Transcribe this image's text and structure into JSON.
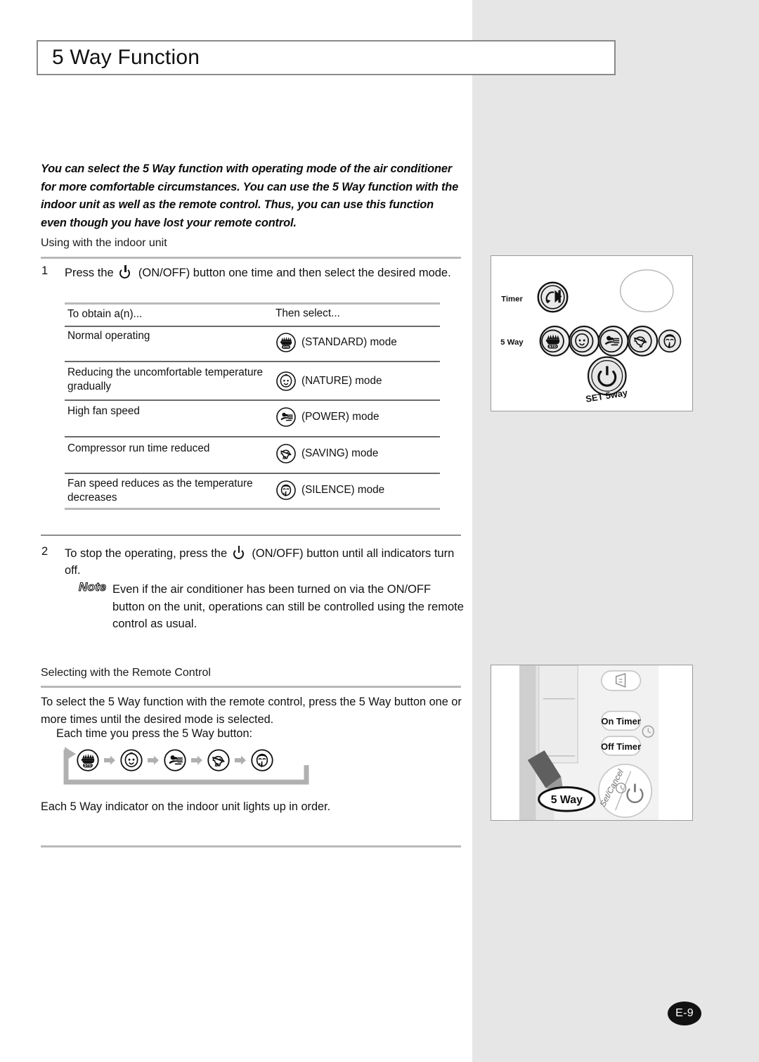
{
  "page": {
    "title": "5 Way Function",
    "footer_label": "E-9",
    "accent_gray": "#e6e6e6",
    "rule_color": "#b9b9b9"
  },
  "intro": {
    "paragraph": "You can select the 5 Way function with operating mode of the air conditioner for more comfortable circumstances. You can use the 5 Way function with the indoor unit as well as the remote control. Thus, you can use this function even though you have lost your remote control."
  },
  "indoor_section": {
    "subhead": "Using with the indoor unit",
    "step1": {
      "number": "1",
      "text_before_icon": "Press the",
      "icon": "power-on-off-icon",
      "text_after_icon": "(ON/OFF) button one time and then select the desired mode."
    },
    "table": {
      "headers": {
        "left": "To obtain a(n)...",
        "right": "Then select..."
      },
      "rows": [
        {
          "condition": "Normal operating",
          "icon": "standard-mode-icon",
          "mode_label": "(STANDARD) mode"
        },
        {
          "condition": "Reducing the uncomfortable temperature gradually",
          "icon": "nature-mode-icon",
          "mode_label": "(NATURE) mode"
        },
        {
          "condition": "High fan speed",
          "icon": "power-mode-icon",
          "mode_label": "(POWER) mode"
        },
        {
          "condition": "Compressor run time reduced",
          "icon": "saving-mode-icon",
          "mode_label": "(SAVING) mode"
        },
        {
          "condition": "Fan speed reduces as the temperature decreases",
          "icon": "silence-mode-icon",
          "mode_label": "(SILENCE) mode"
        }
      ]
    },
    "step2": {
      "number": "2",
      "text_before_icon": "To stop the operating, press the",
      "icon": "power-on-off-icon",
      "text_after_icon": "(ON/OFF) button until all indicators turn off."
    },
    "note": {
      "label": "Note",
      "text": "Even if the air conditioner has been turned on via the ON/OFF button on the unit, operations can still be controlled using the remote control as usual."
    }
  },
  "remote_section": {
    "subhead": "Selecting with the Remote Control",
    "paragraph": "To select the 5 Way function with the remote control, press the 5 Way button one or more times until the desired mode is selected.",
    "sub_label": "Each time you press the 5 Way button:",
    "cycle_icons": [
      "standard-mode-icon",
      "nature-mode-icon",
      "power-mode-icon",
      "saving-mode-icon",
      "silence-mode-icon"
    ],
    "closing": "Each 5 Way indicator on the indoor unit lights up in order."
  },
  "figures": {
    "indoor_unit_panel": {
      "timer_label": "Timer",
      "five_way_label": "5 Way",
      "set_button_label": "SET 5way",
      "timer_icon": "timer-icon",
      "power_icon": "power-on-off-icon",
      "indicator_icons": [
        "standard-mode-icon",
        "nature-mode-icon",
        "power-mode-icon",
        "saving-mode-icon",
        "silence-mode-icon"
      ]
    },
    "remote_control": {
      "buttons": [
        {
          "label": "",
          "icon": "fan-speed-icon"
        },
        {
          "label": "On Timer",
          "icon": ""
        },
        {
          "label": "Off Timer",
          "icon": ""
        }
      ],
      "clock_icon": "clock-icon",
      "set_cancel_label": "Set/Cancel",
      "power_icon": "power-on-off-icon",
      "callout_label": "5 Way"
    }
  }
}
